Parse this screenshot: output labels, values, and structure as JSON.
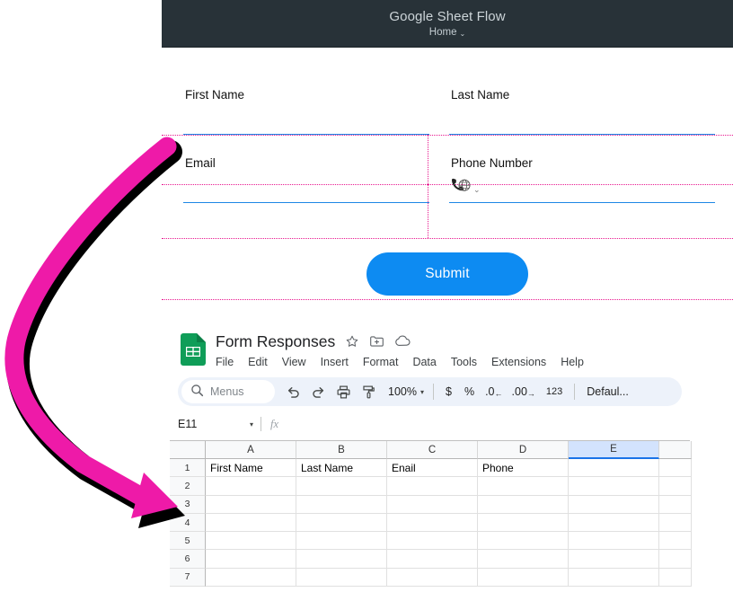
{
  "form_app": {
    "header": {
      "title": "Google Sheet Flow",
      "nav_label": "Home",
      "nav_caret": "⌄",
      "bg_color": "#283238"
    },
    "fields": [
      {
        "label": "First Name",
        "value": "",
        "placeholder": ""
      },
      {
        "label": "Last Name",
        "value": "",
        "placeholder": ""
      },
      {
        "label": "Email",
        "value": "",
        "placeholder": ""
      },
      {
        "label": "Phone Number",
        "value": "",
        "placeholder": "",
        "prefix_icon": "phone-globe-icon",
        "prefix_caret": "⌄"
      }
    ],
    "submit": {
      "label": "Submit",
      "color": "#0d8bf2"
    },
    "guideline_color": "#e8188f"
  },
  "sheet": {
    "doc_title": "Form Responses",
    "title_icons": [
      "star-icon",
      "move-to-folder-icon",
      "cloud-saved-icon"
    ],
    "menus": [
      "File",
      "Edit",
      "View",
      "Insert",
      "Format",
      "Data",
      "Tools",
      "Extensions",
      "Help"
    ],
    "toolbar": {
      "search_placeholder": "Menus",
      "search_icon": "search-icon",
      "undo": "undo-icon",
      "redo": "redo-icon",
      "print": "print-icon",
      "paint_format": "paint-format-icon",
      "zoom_value": "100%",
      "zoom_caret": "▾",
      "currency": "$",
      "percent": "%",
      "decrease_decimal": ".0",
      "decrease_decimal_arrow": "←",
      "increase_decimal": ".00",
      "increase_decimal_arrow": "→",
      "number_format": "123",
      "font_name": "Defaul..."
    },
    "formula_bar": {
      "name_box": "E11",
      "name_box_caret": "▾",
      "fx_label": "fx",
      "formula_value": ""
    },
    "grid": {
      "columns": [
        "A",
        "B",
        "C",
        "D",
        "E"
      ],
      "selected_column": "E",
      "row_numbers": [
        "1",
        "2",
        "3",
        "4",
        "5",
        "6",
        "7"
      ],
      "rows": [
        [
          "First Name",
          "Last Name",
          "Enail",
          "Phone",
          ""
        ],
        [
          "",
          "",
          "",
          "",
          ""
        ],
        [
          "",
          "",
          "",
          "",
          ""
        ],
        [
          "",
          "",
          "",
          "",
          ""
        ],
        [
          "",
          "",
          "",
          "",
          ""
        ],
        [
          "",
          "",
          "",
          "",
          ""
        ],
        [
          "",
          "",
          "",
          "",
          ""
        ]
      ]
    }
  },
  "annotation": {
    "arrow_color": "#ee1aa8",
    "arrow_shadow_color": "#000000",
    "arrow_name": "curved-pink-arrow"
  }
}
